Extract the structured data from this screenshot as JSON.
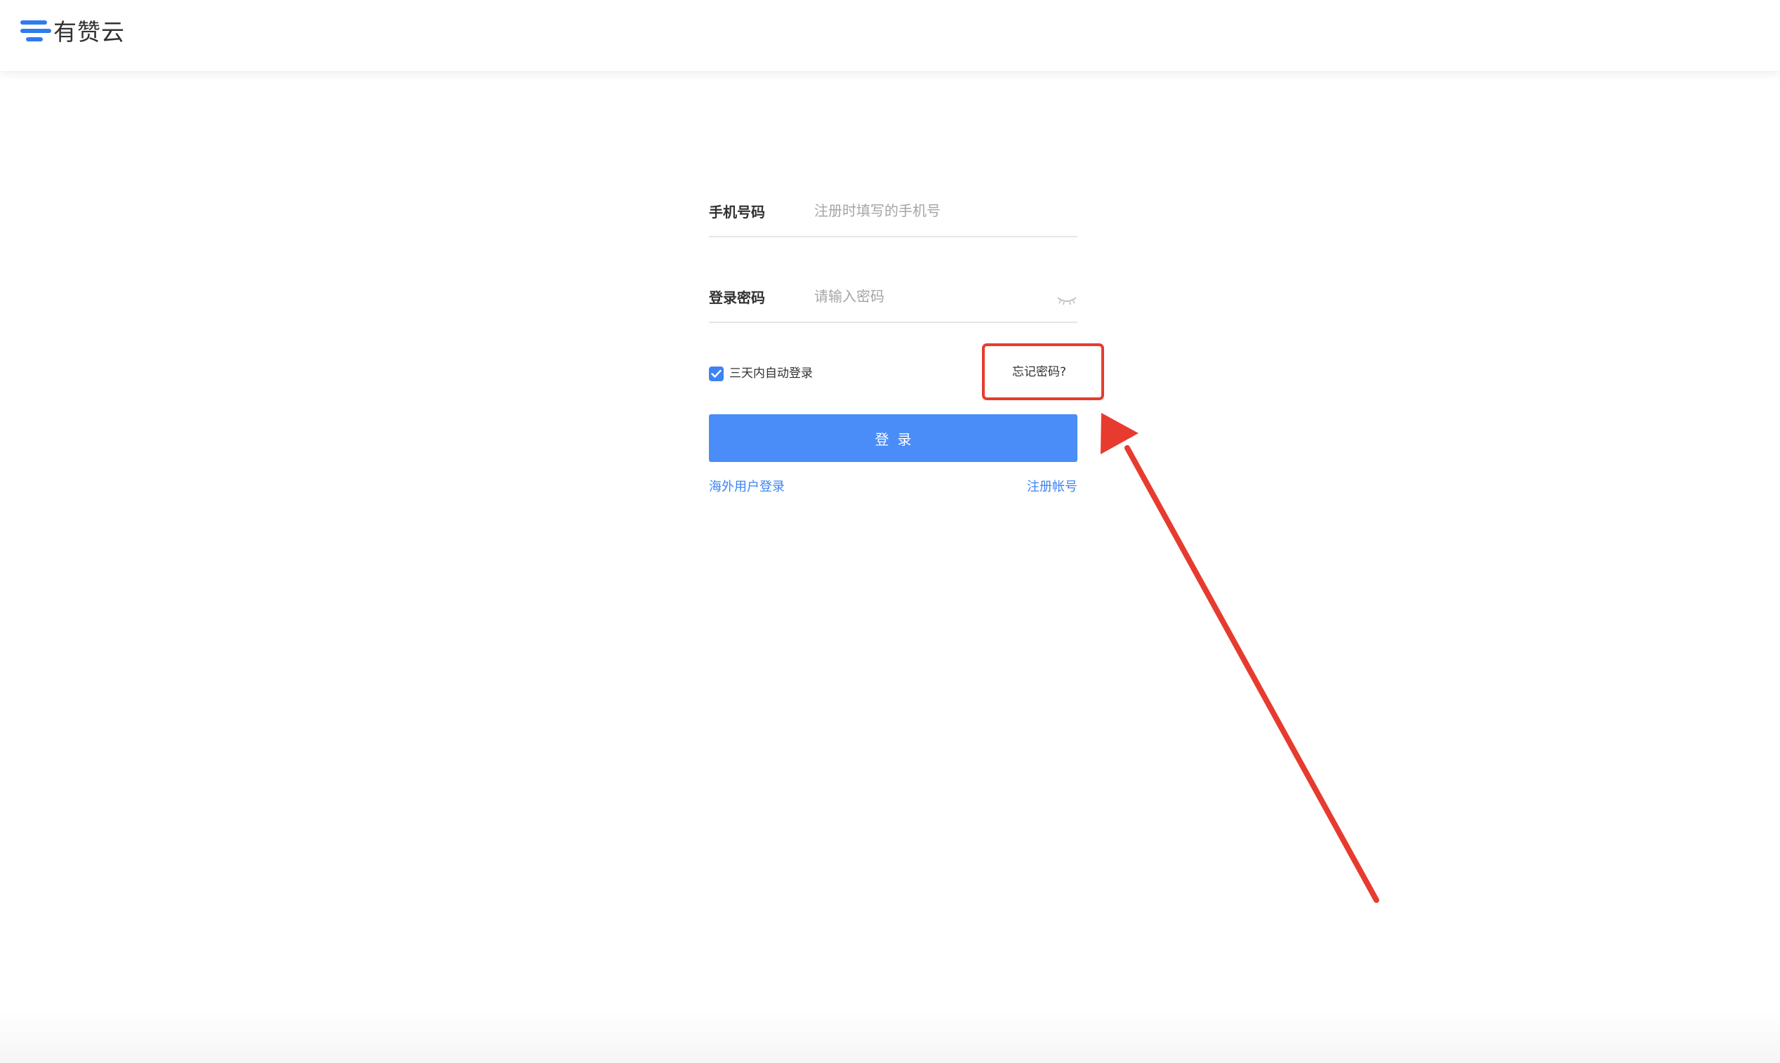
{
  "header": {
    "logo_text": "有赞云",
    "brand_color": "#2f7bf0"
  },
  "login_form": {
    "phone": {
      "label": "手机号码",
      "placeholder": "注册时填写的手机号",
      "value": ""
    },
    "password": {
      "label": "登录密码",
      "placeholder": "请输入密码",
      "value": "",
      "toggle_icon": "eye-closed-icon"
    },
    "remember": {
      "label": "三天内自动登录",
      "checked": true
    },
    "forgot_label": "忘记密码?",
    "submit_label": "登录",
    "overseas_login_label": "海外用户登录",
    "register_label": "注册帐号",
    "accent_color": "#4a8df8"
  },
  "annotation": {
    "color": "#e73b2f",
    "target": "forgot-password-link"
  }
}
